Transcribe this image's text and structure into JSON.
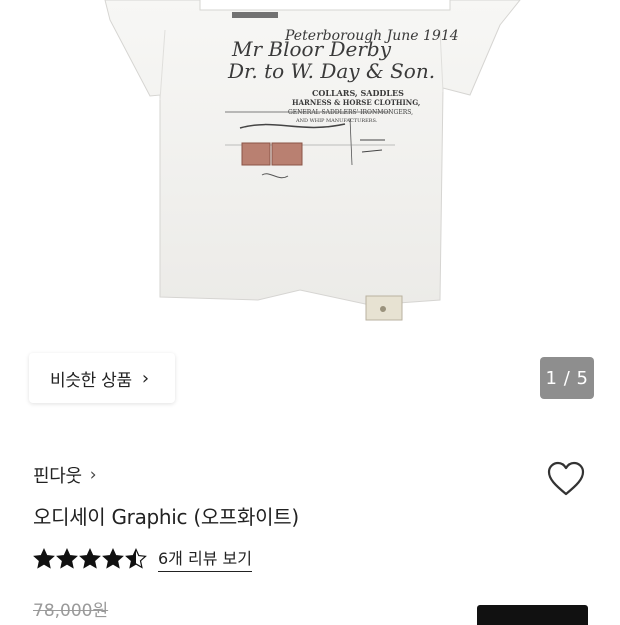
{
  "product_image": {
    "tshirt_print_lines": [
      "Peterborough June 1914",
      "Mr Bloor Derby",
      "Dr. to W. Day & Son.",
      "COLLARS, SADDLES",
      "HARNESS & HORSE CLOTHING,",
      "GENERAL SADDLERS' IRONMONGERS,",
      "AND WHIP MANUFACTURERS."
    ]
  },
  "similar_products": {
    "label": "비슷한 상품"
  },
  "gallery": {
    "counter": "1 / 5"
  },
  "brand": {
    "name": "핀다웃"
  },
  "product": {
    "title": "오디세이 Graphic (오프화이트)"
  },
  "rating": {
    "value": 4.5,
    "max": 5,
    "review_link": "6개 리뷰 보기"
  },
  "price": {
    "original": "78,000원"
  },
  "colors": {
    "accent": "#111111",
    "counter_bg": "#8e8e8e",
    "strike_price": "#9a9a9a"
  }
}
